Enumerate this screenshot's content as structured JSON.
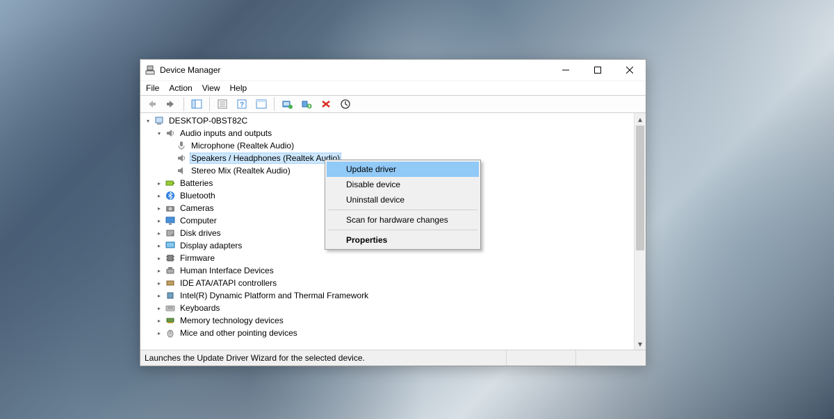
{
  "window": {
    "title": "Device Manager"
  },
  "menubar": [
    "File",
    "Action",
    "View",
    "Help"
  ],
  "tree": {
    "root": "DESKTOP-0BST82C",
    "audio": {
      "label": "Audio inputs and outputs",
      "children": [
        "Microphone (Realtek Audio)",
        "Speakers / Headphones (Realtek Audio)",
        "Stereo Mix (Realtek Audio)"
      ]
    },
    "categories": [
      "Batteries",
      "Bluetooth",
      "Cameras",
      "Computer",
      "Disk drives",
      "Display adapters",
      "Firmware",
      "Human Interface Devices",
      "IDE ATA/ATAPI controllers",
      "Intel(R) Dynamic Platform and Thermal Framework",
      "Keyboards",
      "Memory technology devices",
      "Mice and other pointing devices"
    ]
  },
  "context_menu": {
    "items": [
      "Update driver",
      "Disable device",
      "Uninstall device",
      "Scan for hardware changes",
      "Properties"
    ]
  },
  "statusbar": "Launches the Update Driver Wizard for the selected device."
}
